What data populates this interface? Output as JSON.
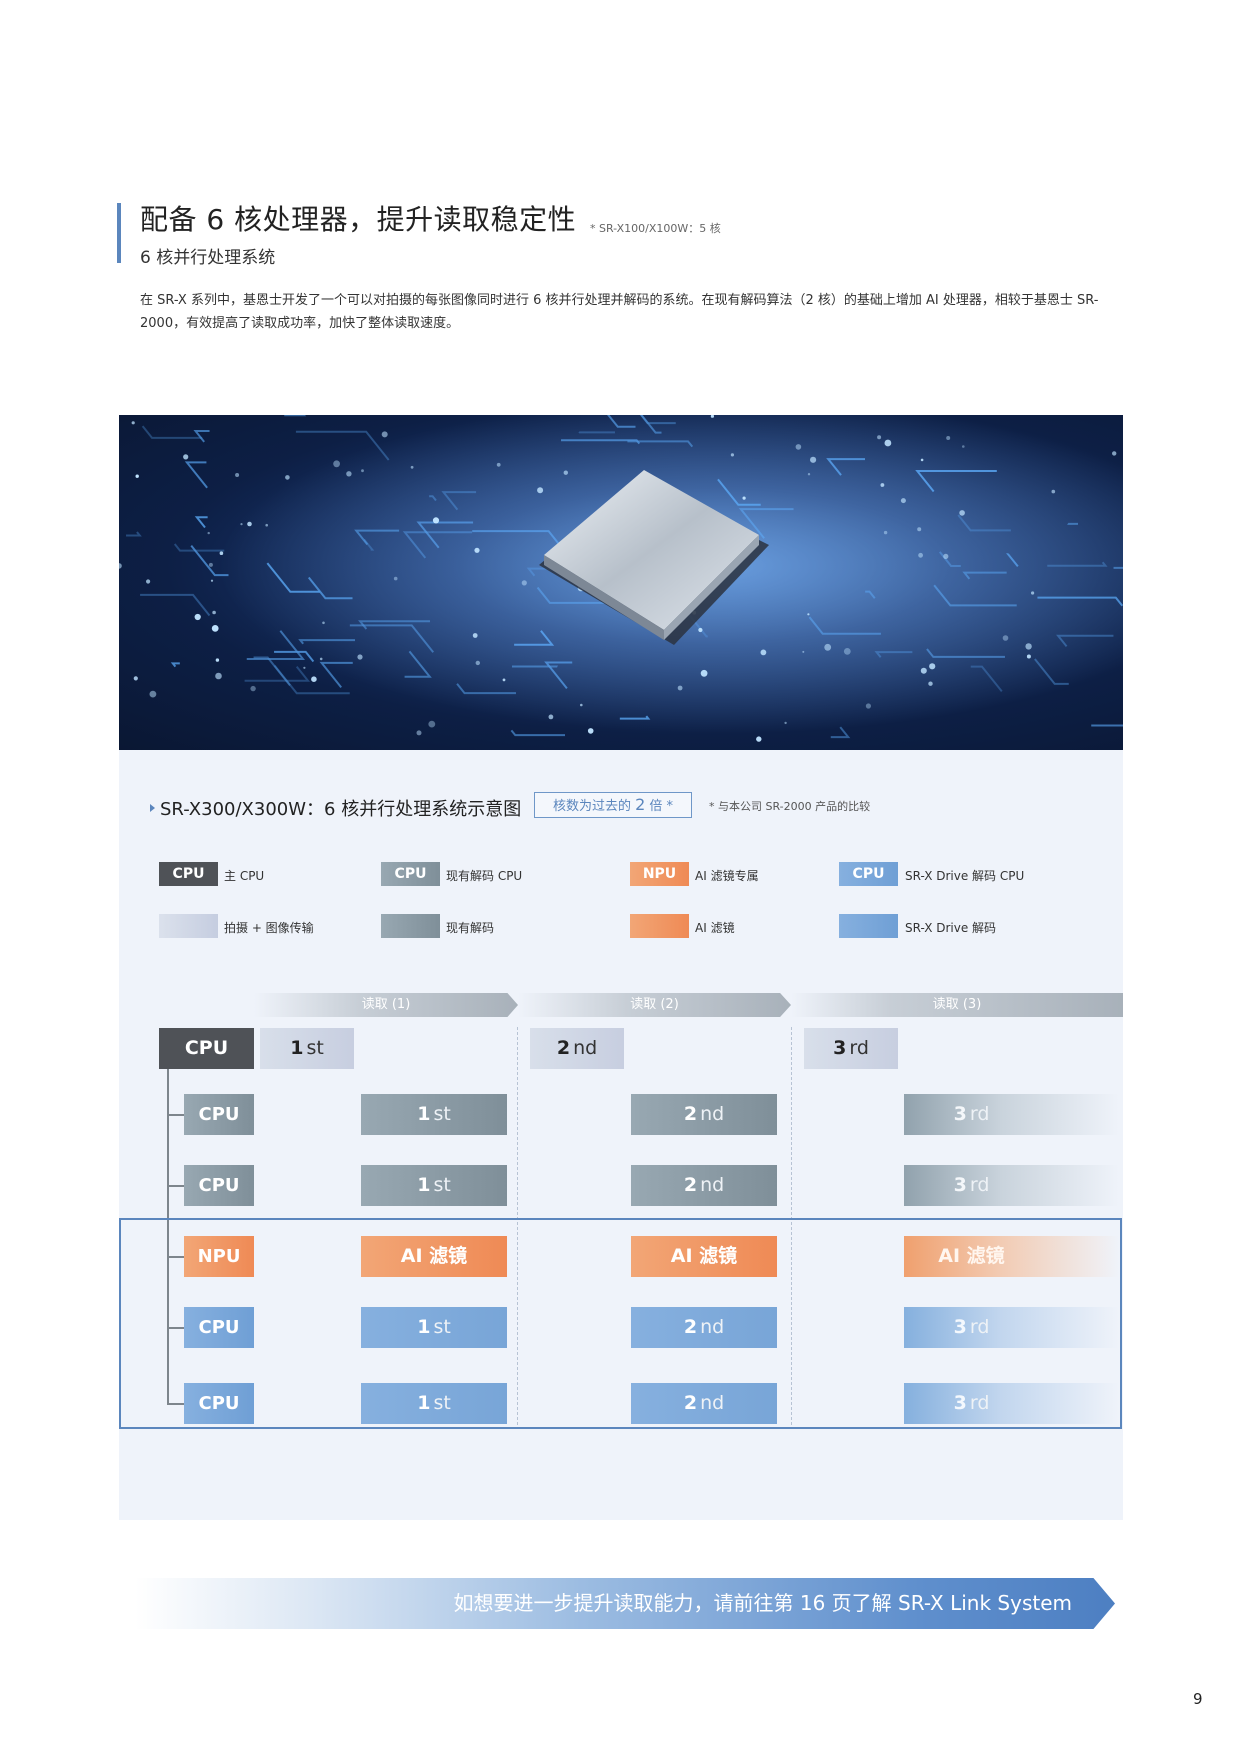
{
  "heading": {
    "title": "配备 6 核处理器，提升读取稳定性",
    "title_note": "* SR-X100/X100W：5 核",
    "subtitle": "6 核并行处理系统",
    "accent_color": "#5b86bd"
  },
  "intro": "在 SR-X 系列中，基恩士开发了一个可以对拍摄的每张图像同时进行 6 核并行处理并解码的系统。在现有解码算法（2 核）的基础上增加 AI 处理器，相较于基恩士 SR-2000，有效提高了读取成功率，加快了整体读取速度。",
  "photo": {
    "alt": "circuit-board-processor-chip"
  },
  "diagram": {
    "title": "SR-X300/X300W：6 核并行处理系统示意图",
    "badge_prefix": "核数为过去的 ",
    "badge_num": "2",
    "badge_suffix": " 倍 *",
    "badge_note": "* 与本公司 SR-2000 产品的比较",
    "legend": [
      {
        "swatch": "CPU",
        "label": "主 CPU",
        "color": "#4f5257"
      },
      {
        "swatch": "CPU",
        "label": "现有解码 CPU",
        "color": "#8796a0"
      },
      {
        "swatch": "NPU",
        "label": "AI 滤镜专属",
        "color": "#ef8a55"
      },
      {
        "swatch": "CPU",
        "label": "SR-X Drive 解码 CPU",
        "color": "#78a5d7"
      },
      {
        "swatch": "",
        "label": "拍摄 + 图像传输",
        "color": "#c7cee0"
      },
      {
        "swatch": "",
        "label": "现有解码",
        "color": "#8796a0"
      },
      {
        "swatch": "",
        "label": "AI 滤镜",
        "color": "#ef8a55"
      },
      {
        "swatch": "",
        "label": "SR-X Drive 解码",
        "color": "#78a5d7"
      }
    ],
    "phases": [
      "读取 (1)",
      "读取 (2)",
      "读取 (3)"
    ],
    "main_processor": "CPU",
    "captures": [
      {
        "num": "1",
        "suffix": "st"
      },
      {
        "num": "2",
        "suffix": "nd"
      },
      {
        "num": "3",
        "suffix": "rd"
      }
    ],
    "rows": [
      {
        "processor": "CPU",
        "kind": "old",
        "cells": [
          {
            "num": "1",
            "suffix": "st"
          },
          {
            "num": "2",
            "suffix": "nd"
          },
          {
            "num": "3",
            "suffix": "rd"
          }
        ]
      },
      {
        "processor": "CPU",
        "kind": "old",
        "cells": [
          {
            "num": "1",
            "suffix": "st"
          },
          {
            "num": "2",
            "suffix": "nd"
          },
          {
            "num": "3",
            "suffix": "rd"
          }
        ]
      },
      {
        "processor": "NPU",
        "kind": "npu",
        "cells": [
          {
            "text": "AI 滤镜"
          },
          {
            "text": "AI 滤镜"
          },
          {
            "text": "AI 滤镜"
          }
        ]
      },
      {
        "processor": "CPU",
        "kind": "drive",
        "cells": [
          {
            "num": "1",
            "suffix": "st"
          },
          {
            "num": "2",
            "suffix": "nd"
          },
          {
            "num": "3",
            "suffix": "rd"
          }
        ]
      },
      {
        "processor": "CPU",
        "kind": "drive",
        "cells": [
          {
            "num": "1",
            "suffix": "st"
          },
          {
            "num": "2",
            "suffix": "nd"
          },
          {
            "num": "3",
            "suffix": "rd"
          }
        ]
      }
    ]
  },
  "banner": "如想要进一步提升读取能力，请前往第 16 页了解 SR-X Link System",
  "page_number": "9"
}
